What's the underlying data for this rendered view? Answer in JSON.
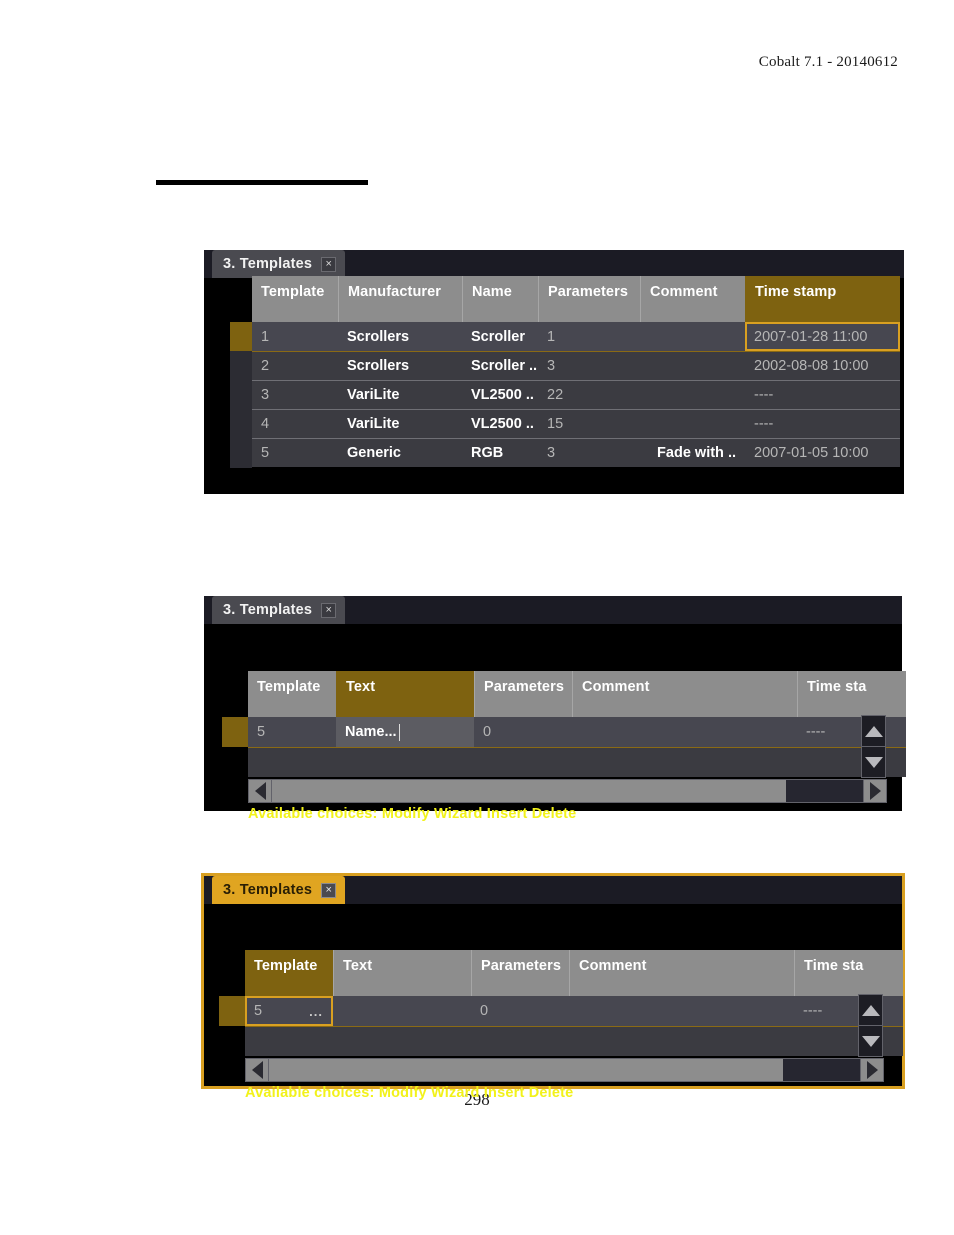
{
  "document": {
    "header": "Cobalt 7.1 - 20140612",
    "page_number": "298"
  },
  "panels": [
    {
      "id": "panel-browse",
      "tab": {
        "label": "3. Templates",
        "close_icon": "close-icon",
        "close_glyph": "×"
      },
      "columns": [
        "Template",
        "Manufacturer",
        "Name",
        "Parameters",
        "Comment",
        "Time stamp"
      ],
      "highlighted_column": "Time stamp",
      "rows": [
        {
          "template": "1",
          "manufacturer": "Scrollers",
          "name": "Scroller",
          "parameters": "1",
          "comment": "",
          "timestamp": "2007-01-28 11:00",
          "selected": true
        },
        {
          "template": "2",
          "manufacturer": "Scrollers",
          "name": "Scroller ..",
          "parameters": "3",
          "comment": "",
          "timestamp": "2002-08-08 10:00",
          "selected": false
        },
        {
          "template": "3",
          "manufacturer": "VariLite",
          "name": "VL2500 ..",
          "parameters": "22",
          "comment": "",
          "timestamp": "----",
          "selected": false
        },
        {
          "template": "4",
          "manufacturer": "VariLite",
          "name": "VL2500 ..",
          "parameters": "15",
          "comment": "",
          "timestamp": "----",
          "selected": false
        },
        {
          "template": "5",
          "manufacturer": "Generic",
          "name": "RGB",
          "parameters": "3",
          "comment": "Fade with ..",
          "timestamp": "2007-01-05 10:00",
          "selected": false
        }
      ]
    },
    {
      "id": "panel-edit-text",
      "tab": {
        "label": "3. Templates",
        "close_icon": "close-icon",
        "close_glyph": "×"
      },
      "columns": [
        "Template",
        "Text",
        "Parameters",
        "Comment",
        "Time sta"
      ],
      "highlighted_column": "Text",
      "row": {
        "template": "5",
        "text_value": "Name...",
        "parameters": "0",
        "comment": "",
        "timestamp": "----"
      },
      "status": "Available choices: Modify Wizard Insert Delete",
      "scroll": {
        "up_icon": "triangle-up-icon",
        "down_icon": "triangle-down-icon",
        "left_icon": "triangle-left-icon",
        "right_icon": "triangle-right-icon"
      }
    },
    {
      "id": "panel-select-template",
      "tab": {
        "label": "3. Templates",
        "close_icon": "close-icon",
        "close_glyph": "×"
      },
      "columns": [
        "Template",
        "Text",
        "Parameters",
        "Comment",
        "Time sta"
      ],
      "highlighted_column": "Template",
      "row": {
        "template": "5",
        "template_ellipsis": "...",
        "text_value": "",
        "parameters": "0",
        "comment": "",
        "timestamp": "----"
      },
      "status": "Available choices: Modify Wizard Insert Delete",
      "scroll": {
        "up_icon": "triangle-up-icon",
        "down_icon": "triangle-down-icon",
        "left_icon": "triangle-left-icon",
        "right_icon": "triangle-right-icon"
      }
    }
  ],
  "colors": {
    "gold_header": "#7e6210",
    "gold_accent": "#d9a021",
    "tab_active": "#e0a521",
    "status_yellow": "#f2f21a",
    "header_gray": "#8d8d8d",
    "row_gray": "#3b3b41"
  }
}
